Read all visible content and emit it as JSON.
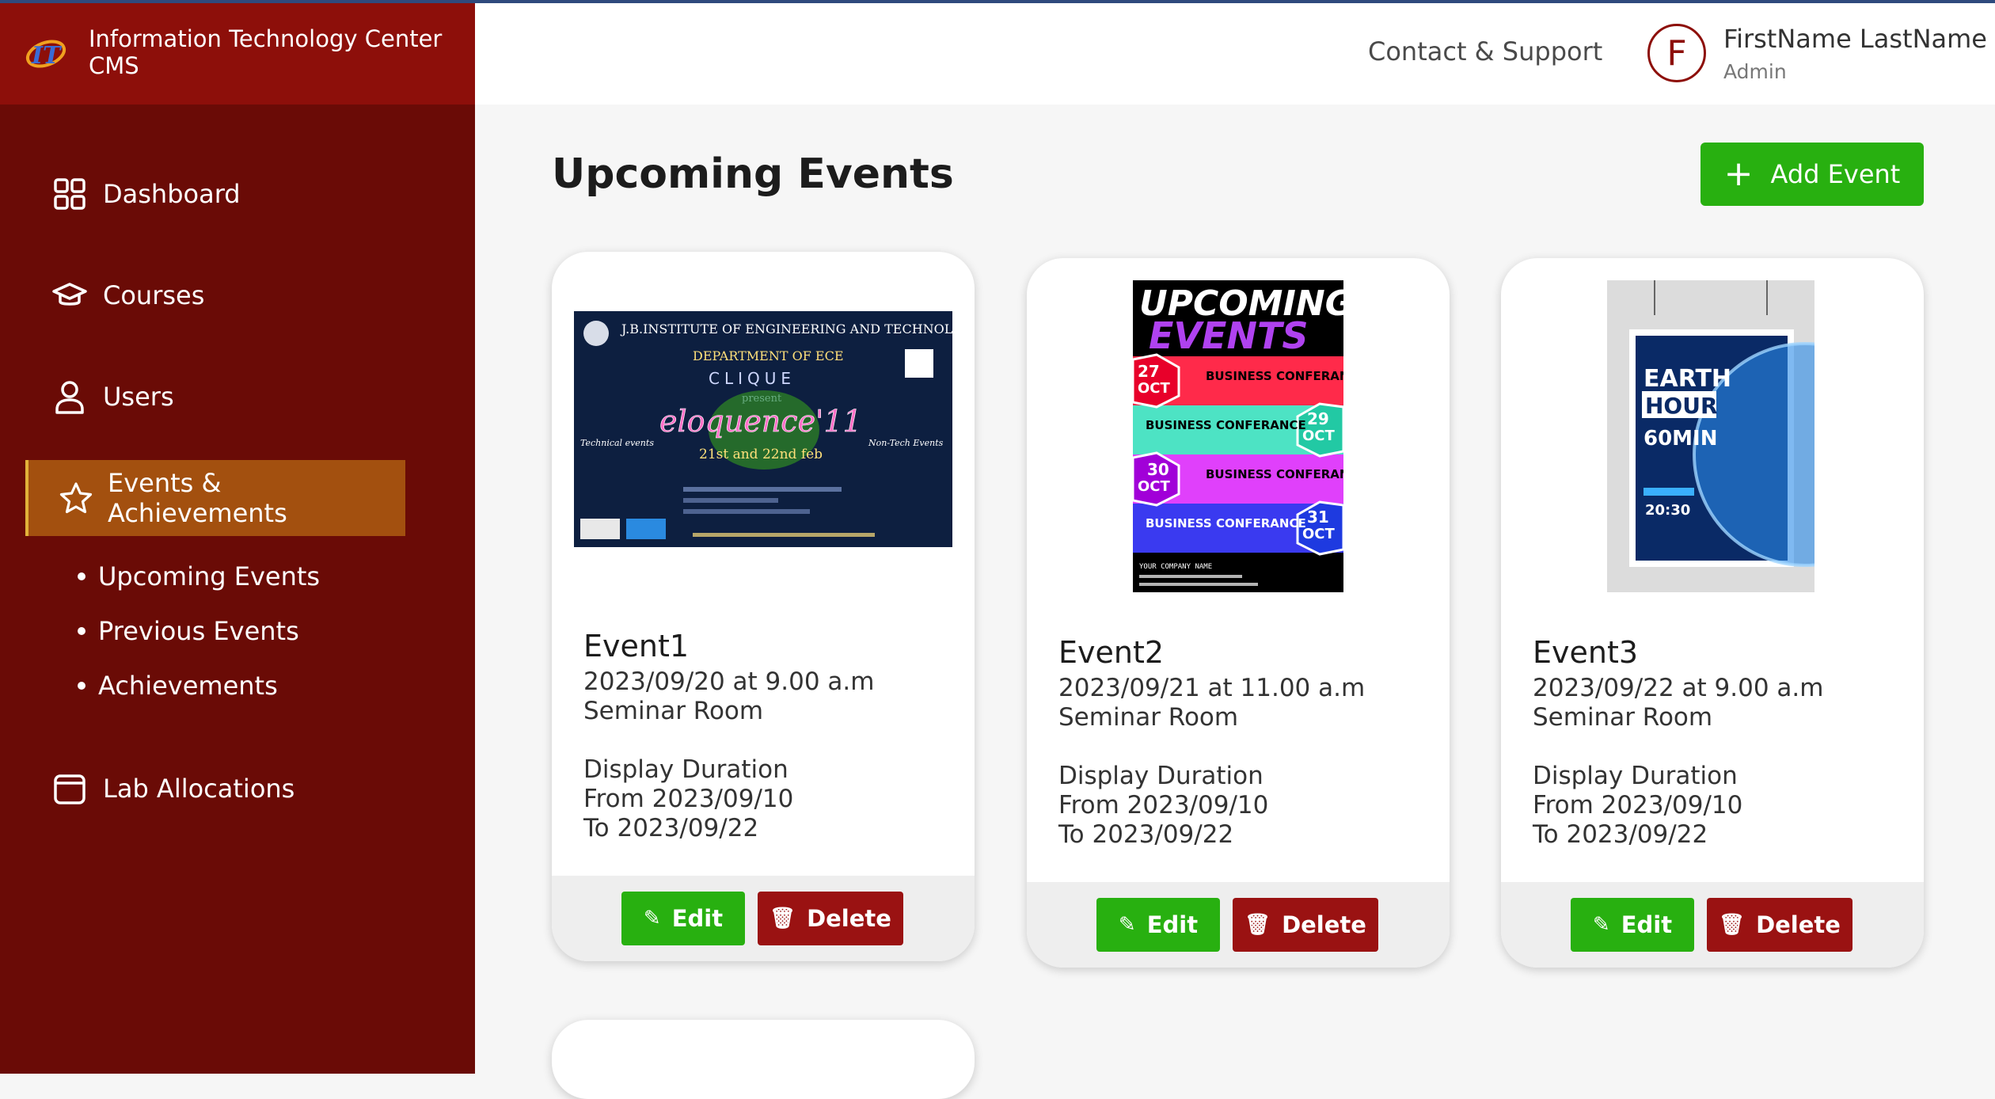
{
  "brand": {
    "title_line1": "Information Technology Center",
    "title_line2": "CMS"
  },
  "header": {
    "contact": "Contact & Support",
    "avatar_initial": "F",
    "user_name": "FirstName LastName",
    "user_role": "Admin"
  },
  "sidebar": {
    "items": [
      {
        "label": "Dashboard",
        "icon": "grid-icon"
      },
      {
        "label": "Courses",
        "icon": "graduation-cap-icon"
      },
      {
        "label": "Users",
        "icon": "user-icon"
      },
      {
        "label": "Events & Achievements",
        "icon": "star-icon",
        "active": true
      },
      {
        "label": "Lab Allocations",
        "icon": "calendar-icon"
      }
    ],
    "subitems": [
      "Upcoming Events",
      "Previous Events",
      "Achievements"
    ]
  },
  "main": {
    "title": "Upcoming Events",
    "add_button": "Add Event",
    "edit_label": "Edit",
    "delete_label": "Delete",
    "events": [
      {
        "name": "Event1",
        "datetime": "2023/09/20 at 9.00 a.m",
        "venue": "Seminar Room",
        "duration_label": "Display Duration",
        "from": "From 2023/09/10",
        "to": "To 2023/09/22",
        "poster": {
          "institute": "J.B.INSTITUTE OF ENGINEERING AND TECHNOLOGY",
          "dept": "DEPARTMENT OF ECE",
          "club": "CLIQUE",
          "present": "present",
          "event": "eloquence'11",
          "dates": "21st and 22nd feb",
          "tech": "Technical events",
          "nontech": "Non-Tech Events"
        }
      },
      {
        "name": "Event2",
        "datetime": "2023/09/21 at 11.00 a.m",
        "venue": "Seminar Room",
        "duration_label": "Display Duration",
        "from": "From 2023/09/10",
        "to": "To 2023/09/22",
        "poster": {
          "line1": "UPCOMING",
          "line2": "EVENTS",
          "rows": [
            {
              "day": "27",
              "mon": "OCT",
              "title": "BUSINESS CONFERANCE"
            },
            {
              "day": "29",
              "mon": "OCT",
              "title": "BUSINESS CONFERANCE"
            },
            {
              "day": "30",
              "mon": "OCT",
              "title": "BUSINESS CONFERANCE"
            },
            {
              "day": "31",
              "mon": "OCT",
              "title": "BUSINESS CONFERANCE"
            }
          ],
          "footer": "YOUR COMPANY NAME"
        }
      },
      {
        "name": "Event3",
        "datetime": "2023/09/22 at 9.00 a.m",
        "venue": "Seminar Room",
        "duration_label": "Display Duration",
        "from": "From 2023/09/10",
        "to": "To 2023/09/22",
        "poster": {
          "line1": "EARTH",
          "line2": "HOUR",
          "line3": "60MIN",
          "time": "20:30"
        }
      }
    ]
  }
}
